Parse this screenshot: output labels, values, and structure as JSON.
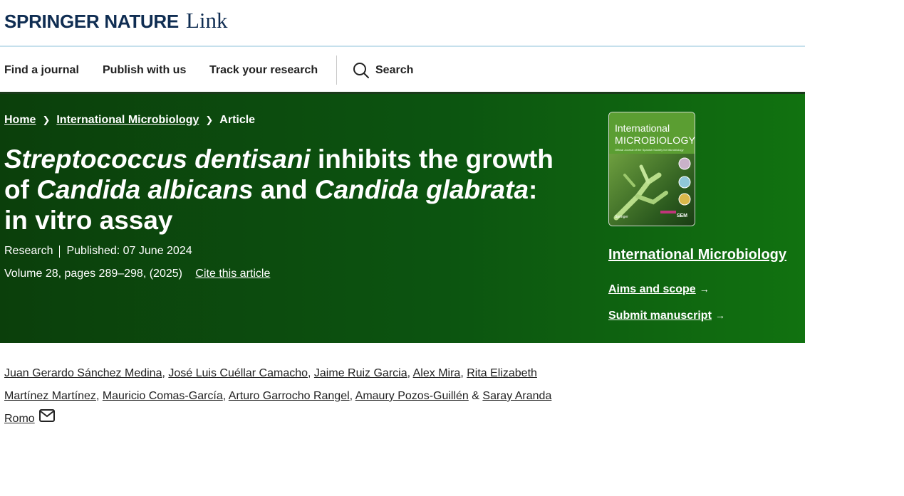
{
  "header": {
    "brand": "SPRINGER NATURE",
    "brand_link": "Link"
  },
  "nav": {
    "find_journal": "Find a journal",
    "publish": "Publish with us",
    "track": "Track your research",
    "search": "Search"
  },
  "breadcrumb": {
    "home": "Home",
    "journal": "International Microbiology",
    "current": "Article"
  },
  "article": {
    "title_p1": "Streptococcus dentisani",
    "title_p2": " inhibits the growth of ",
    "title_p3": "Candida albicans",
    "title_p4": " and ",
    "title_p5": "Candida glabrata",
    "title_p6": ": in vitro assay",
    "type": "Research",
    "published": "Published: 07 June 2024",
    "volume": "Volume 28, pages 289–298, (2025)",
    "cite": "Cite this article"
  },
  "journal_panel": {
    "cover_title_1": "International",
    "cover_title_2": "MICROBIOLOGY",
    "cover_subtitle": "Official Journal of the Spanish Society for Microbiology",
    "cover_publisher": "Springer",
    "cover_badge": "SEM",
    "name": "International Microbiology",
    "aims": "Aims and scope",
    "submit": "Submit manuscript"
  },
  "authors": [
    "Juan Gerardo Sánchez Medina",
    "José Luis Cuéllar Camacho",
    "Jaime Ruiz Garcia",
    "Alex Mira",
    "Rita Elizabeth Martínez Martínez",
    "Mauricio Comas-García",
    "Arturo Garrocho Rangel",
    "Amaury Pozos-Guillén",
    "Saray Aranda Romo"
  ],
  "authors_sep": {
    "comma": ", ",
    "amp": " & "
  },
  "icons": {
    "search": "search-icon",
    "chevron": "chevron-right-icon",
    "arrow": "arrow-right-icon",
    "mail": "mail-icon"
  },
  "colors": {
    "hero_start": "#0b3f0b",
    "hero_end": "#117210",
    "brand": "#0f2d52"
  }
}
